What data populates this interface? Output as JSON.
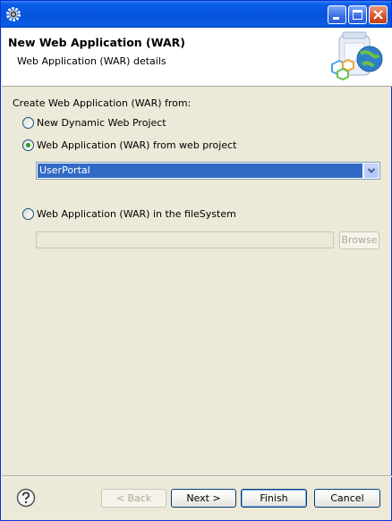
{
  "window": {
    "title": ""
  },
  "header": {
    "title": "New Web Application (WAR)",
    "description": "Web Application (WAR) details"
  },
  "form": {
    "group_label": "Create Web Application (WAR) from:",
    "options": [
      {
        "label": "New Dynamic Web Project",
        "checked": false
      },
      {
        "label": "Web Application (WAR) from web project",
        "checked": true
      },
      {
        "label": "Web Application (WAR) in the fileSystem",
        "checked": false
      }
    ],
    "project_combo": {
      "selected": "UserPortal"
    },
    "file_path": {
      "value": ""
    },
    "browse_label": "Browse"
  },
  "buttons": {
    "back": "< Back",
    "next": "Next >",
    "finish": "Finish",
    "cancel": "Cancel"
  },
  "colors": {
    "titlebar": "#0655e0",
    "selection": "#316ac5",
    "radio_dot": "#21a121"
  }
}
